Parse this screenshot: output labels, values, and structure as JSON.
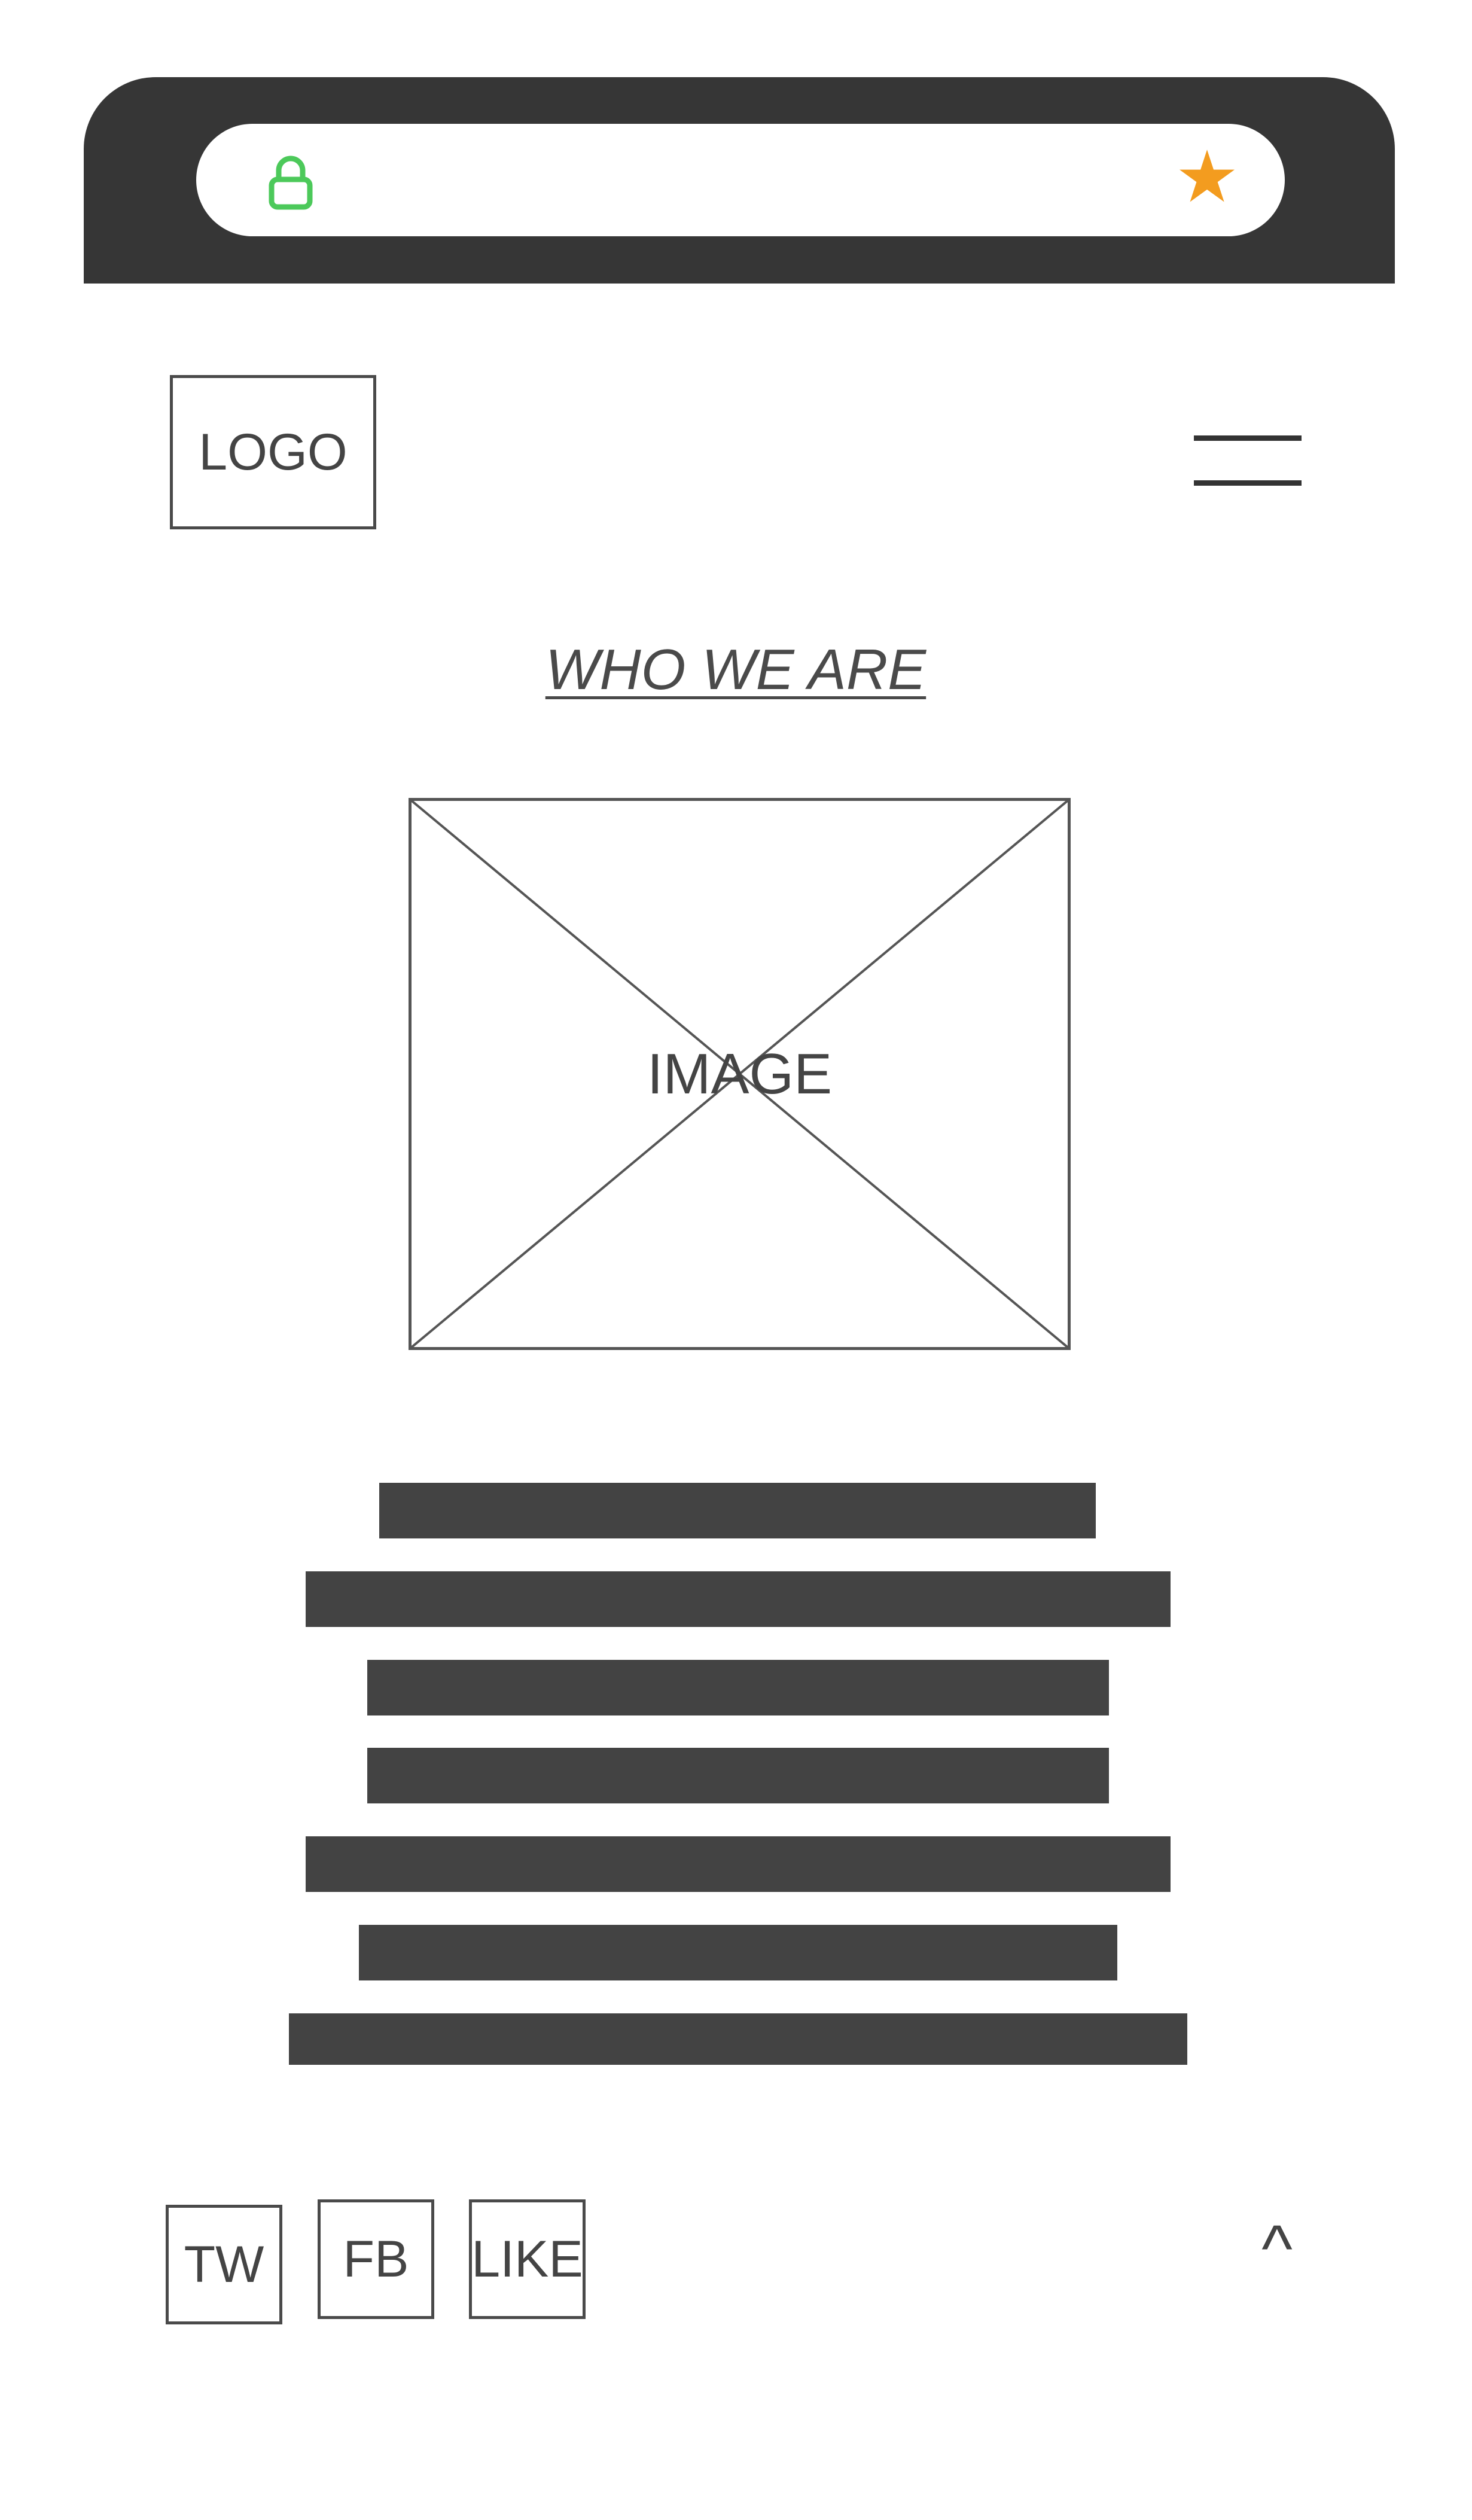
{
  "browser": {
    "lock_icon": "lock-icon",
    "star_icon": "star-icon",
    "lock_color": "#4cc95a",
    "star_color": "#f39c1f",
    "star_glyph": "★"
  },
  "header": {
    "logo_label": "LOGO",
    "menu_icon": "hamburger-menu-icon"
  },
  "main": {
    "title": "WHO WE ARE",
    "image_label": "IMAGE",
    "text_line_count": 7
  },
  "footer": {
    "social": [
      {
        "label": "TW"
      },
      {
        "label": "FB"
      },
      {
        "label": "LIKE"
      }
    ],
    "back_to_top": "^"
  }
}
